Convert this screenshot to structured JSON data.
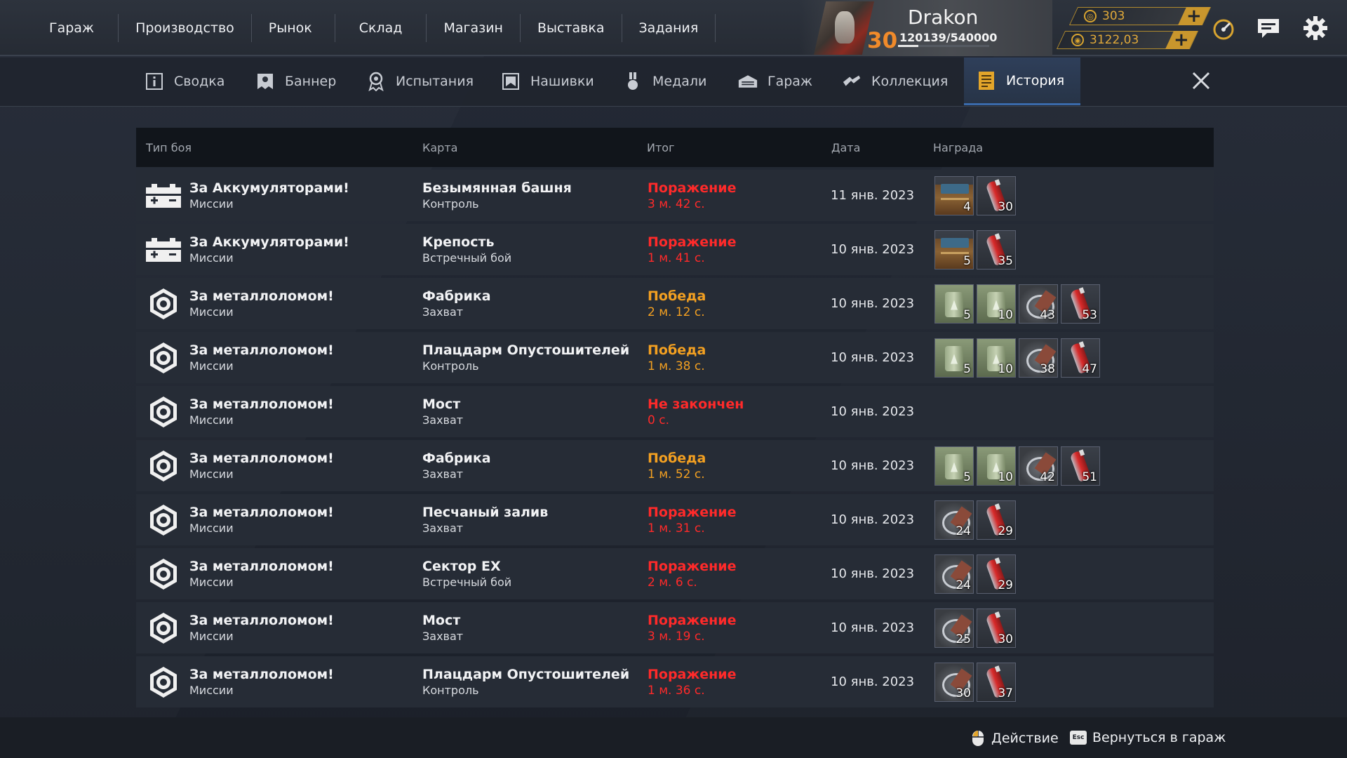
{
  "main_nav": [
    "Гараж",
    "Производство",
    "Рынок",
    "Склад",
    "Магазин",
    "Выставка",
    "Задания"
  ],
  "profile": {
    "level": "30",
    "username": "Drakon",
    "xp": "120139/540000",
    "xp_fraction": 0.222,
    "level_color": "#f08a2a"
  },
  "currency": [
    {
      "name": "coin-icon",
      "value": "303",
      "plus": "+"
    },
    {
      "name": "credits-icon",
      "value": "3122,03",
      "plus": "+"
    }
  ],
  "top_icons": [
    "speedometer-icon",
    "chat-icon",
    "gear-icon"
  ],
  "tabs": [
    {
      "label": "Сводка",
      "icon": "info-icon"
    },
    {
      "label": "Баннер",
      "icon": "banner-icon"
    },
    {
      "label": "Испытания",
      "icon": "trophy-icon"
    },
    {
      "label": "Нашивки",
      "icon": "patch-icon"
    },
    {
      "label": "Медали",
      "icon": "medal-icon"
    },
    {
      "label": "Гараж",
      "icon": "garage-icon"
    },
    {
      "label": "Коллекция",
      "icon": "collection-icon"
    },
    {
      "label": "История",
      "icon": "history-icon",
      "active": true
    }
  ],
  "close_icon": "close-icon",
  "table": {
    "headers": {
      "type": "Тип боя",
      "map": "Карта",
      "result": "Итог",
      "date": "Дата",
      "reward": "Награда"
    },
    "rows": [
      {
        "icon": "battery-icon",
        "type": "За Аккумуляторами!",
        "mode": "Миссии",
        "map": "Безымянная башня",
        "map_mode": "Контроль",
        "result": "Поражение",
        "duration": "3 м. 42 с.",
        "status": "loss",
        "date": "11 янв. 2023",
        "rewards": [
          {
            "kind": "crate",
            "count": "4"
          },
          {
            "kind": "fuel",
            "count": "30"
          }
        ]
      },
      {
        "icon": "battery-icon",
        "type": "За Аккумуляторами!",
        "mode": "Миссии",
        "map": "Крепость",
        "map_mode": "Встречный бой",
        "result": "Поражение",
        "duration": "1 м. 41 с.",
        "status": "loss",
        "date": "10 янв. 2023",
        "rewards": [
          {
            "kind": "crate",
            "count": "5"
          },
          {
            "kind": "fuel",
            "count": "35"
          }
        ]
      },
      {
        "icon": "scrap-icon",
        "type": "За металлоломом!",
        "mode": "Миссии",
        "map": "Фабрика",
        "map_mode": "Захват",
        "result": "Победа",
        "duration": "2 м. 12 с.",
        "status": "win",
        "date": "10 янв. 2023",
        "rewards": [
          {
            "kind": "jar",
            "count": "5"
          },
          {
            "kind": "jar",
            "count": "10"
          },
          {
            "kind": "scrap",
            "count": "43"
          },
          {
            "kind": "fuel",
            "count": "53"
          }
        ]
      },
      {
        "icon": "scrap-icon",
        "type": "За металлоломом!",
        "mode": "Миссии",
        "map": "Плацдарм Опустошителей",
        "map_mode": "Контроль",
        "result": "Победа",
        "duration": "1 м. 38 с.",
        "status": "win",
        "date": "10 янв. 2023",
        "rewards": [
          {
            "kind": "jar",
            "count": "5"
          },
          {
            "kind": "jar",
            "count": "10"
          },
          {
            "kind": "scrap",
            "count": "38"
          },
          {
            "kind": "fuel",
            "count": "47"
          }
        ]
      },
      {
        "icon": "scrap-icon",
        "type": "За металлоломом!",
        "mode": "Миссии",
        "map": "Мост",
        "map_mode": "Захват",
        "result": "Не закончен",
        "duration": "0 с.",
        "status": "unfinished",
        "date": "10 янв. 2023",
        "rewards": []
      },
      {
        "icon": "scrap-icon",
        "type": "За металлоломом!",
        "mode": "Миссии",
        "map": "Фабрика",
        "map_mode": "Захват",
        "result": "Победа",
        "duration": "1 м. 52 с.",
        "status": "win",
        "date": "10 янв. 2023",
        "rewards": [
          {
            "kind": "jar",
            "count": "5"
          },
          {
            "kind": "jar",
            "count": "10"
          },
          {
            "kind": "scrap",
            "count": "42"
          },
          {
            "kind": "fuel",
            "count": "51"
          }
        ]
      },
      {
        "icon": "scrap-icon",
        "type": "За металлоломом!",
        "mode": "Миссии",
        "map": "Песчаный залив",
        "map_mode": "Захват",
        "result": "Поражение",
        "duration": "1 м. 31 с.",
        "status": "loss",
        "date": "10 янв. 2023",
        "rewards": [
          {
            "kind": "scrap",
            "count": "24"
          },
          {
            "kind": "fuel",
            "count": "29"
          }
        ]
      },
      {
        "icon": "scrap-icon",
        "type": "За металлоломом!",
        "mode": "Миссии",
        "map": "Сектор EX",
        "map_mode": "Встречный бой",
        "result": "Поражение",
        "duration": "2 м. 6 с.",
        "status": "loss",
        "date": "10 янв. 2023",
        "rewards": [
          {
            "kind": "scrap",
            "count": "24"
          },
          {
            "kind": "fuel",
            "count": "29"
          }
        ]
      },
      {
        "icon": "scrap-icon",
        "type": "За металлоломом!",
        "mode": "Миссии",
        "map": "Мост",
        "map_mode": "Захват",
        "result": "Поражение",
        "duration": "3 м. 19 с.",
        "status": "loss",
        "date": "10 янв. 2023",
        "rewards": [
          {
            "kind": "scrap",
            "count": "25"
          },
          {
            "kind": "fuel",
            "count": "30"
          }
        ]
      },
      {
        "icon": "scrap-icon",
        "type": "За металлоломом!",
        "mode": "Миссии",
        "map": "Плацдарм Опустошителей",
        "map_mode": "Контроль",
        "result": "Поражение",
        "duration": "1 м. 36 с.",
        "status": "loss",
        "date": "10 янв. 2023",
        "rewards": [
          {
            "kind": "scrap",
            "count": "30"
          },
          {
            "kind": "fuel",
            "count": "37"
          }
        ]
      }
    ]
  },
  "footer": {
    "action_label": "Действие",
    "action_icon": "mouse-icon",
    "back_key": "Esc",
    "back_label": "Вернуться в гараж"
  },
  "colors": {
    "loss": "#ff2a2a",
    "win": "#f3a021",
    "accent_gold": "#c9962d",
    "active_tab": "#2f3f5a"
  }
}
